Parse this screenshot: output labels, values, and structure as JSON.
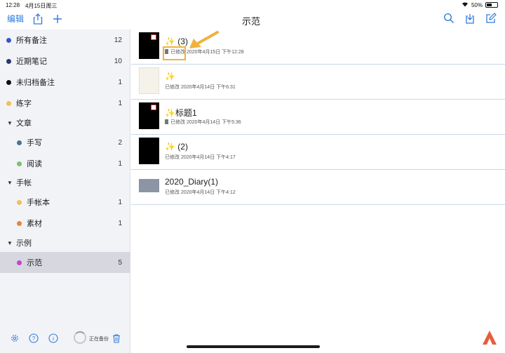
{
  "statusbar": {
    "time": "12:28",
    "date": "4月15日周三",
    "battery": "50%",
    "battery_level": 0.5
  },
  "toolbar": {
    "edit_label": "编辑",
    "title": "示范"
  },
  "sidebar": {
    "items": [
      {
        "label": "所有备注",
        "count": "12",
        "color": "#3a55c8"
      },
      {
        "label": "近期笔记",
        "count": "10",
        "color": "#27386b"
      },
      {
        "label": "未归档备注",
        "count": "1",
        "color": "#111111"
      },
      {
        "label": "练字",
        "count": "1",
        "color": "#f0c05a"
      },
      {
        "label": "文章"
      },
      {
        "label": "手写",
        "count": "2",
        "color": "#4a7590"
      },
      {
        "label": "阅读",
        "count": "1",
        "color": "#7fc06e"
      },
      {
        "label": "手帐"
      },
      {
        "label": "手帐本",
        "count": "1",
        "color": "#f0c05a"
      },
      {
        "label": "素材",
        "count": "1",
        "color": "#e6863a"
      },
      {
        "label": "示例"
      },
      {
        "label": "示范",
        "count": "5",
        "color": "#c444c8"
      }
    ],
    "backup_label": "正在备份"
  },
  "notes": [
    {
      "title": "✨ (3)",
      "meta": "已修改 2020年4月15日 下午12:28"
    },
    {
      "title": "✨",
      "meta": "已修改 2020年4月14日 下午6:31"
    },
    {
      "title": "✨标题1",
      "meta": "已修改 2020年4月14日 下午5:36"
    },
    {
      "title": "✨ (2)",
      "meta": "已修改 2020年4月14日 下午4:17"
    },
    {
      "title": "2020_Diary(1)",
      "meta": "已修改 2020年4月14日 下午4:12"
    }
  ],
  "colors": {
    "accent": "#2f7be0",
    "highlight": "#f0b23c",
    "selected": "#d6d7df"
  }
}
